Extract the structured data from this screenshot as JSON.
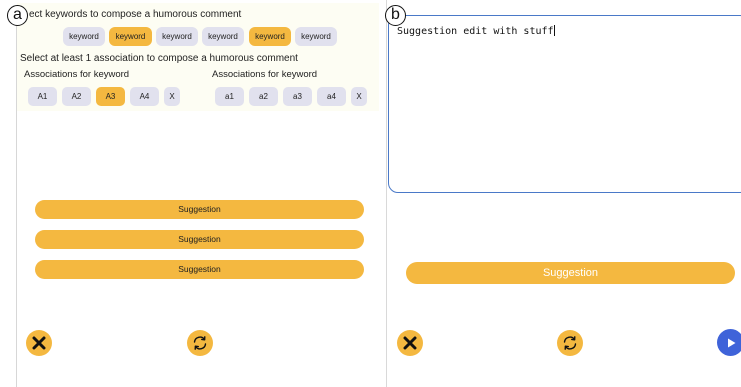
{
  "panel_a": {
    "tag": "a",
    "instruction_keywords": "ect keywords to compose a humorous comment",
    "keywords": [
      {
        "label": "keyword",
        "selected": false
      },
      {
        "label": "keyword",
        "selected": true
      },
      {
        "label": "keyword",
        "selected": false
      },
      {
        "label": "keyword",
        "selected": false
      },
      {
        "label": "keyword",
        "selected": true
      },
      {
        "label": "keyword",
        "selected": false
      }
    ],
    "instruction_assoc": "Select at least 1 association to compose a humorous comment",
    "assoc_group_left": {
      "label": "Associations for keyword",
      "items": [
        {
          "label": "A1",
          "selected": false
        },
        {
          "label": "A2",
          "selected": false
        },
        {
          "label": "A3",
          "selected": true
        },
        {
          "label": "A4",
          "selected": false
        },
        {
          "label": "X",
          "selected": false
        }
      ]
    },
    "assoc_group_right": {
      "label": "Associations for keyword",
      "items": [
        {
          "label": "a1",
          "selected": false
        },
        {
          "label": "a2",
          "selected": false
        },
        {
          "label": "a3",
          "selected": false
        },
        {
          "label": "a4",
          "selected": false
        },
        {
          "label": "X",
          "selected": false
        }
      ]
    },
    "suggestions": [
      "Suggestion",
      "Suggestion",
      "Suggestion"
    ],
    "close_icon": "close-icon",
    "refresh_icon": "refresh-icon"
  },
  "panel_b": {
    "tag": "b",
    "edit_text": "Suggestion edit with stuff",
    "suggestion": "Suggestion",
    "close_icon": "close-icon",
    "refresh_icon": "refresh-icon",
    "send_icon": "play-icon"
  },
  "colors": {
    "accent": "#f4b840",
    "chip": "#e1e1ee",
    "edit_border": "#4a79c8",
    "send": "#3f63d9"
  }
}
